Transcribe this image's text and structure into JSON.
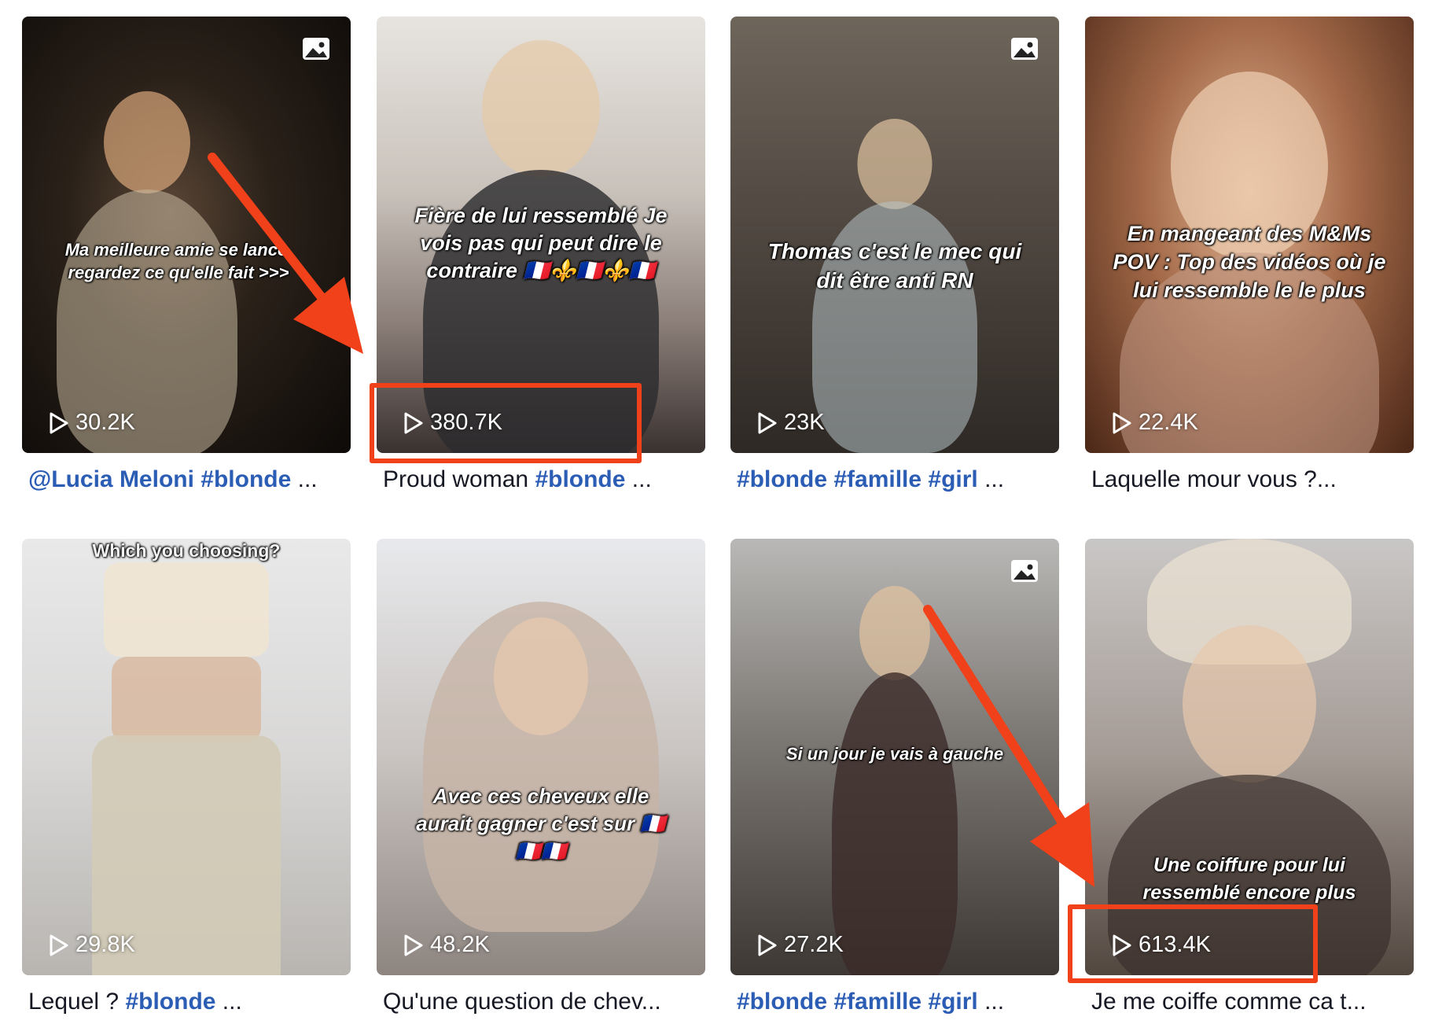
{
  "videos": [
    {
      "views": "30.2K",
      "overlay": "Ma meilleure amie se lance, regardez ce qu'elle fait >>>",
      "caption_user": "@Lucia Meloni",
      "caption_tag": "#blonde",
      "caption_rest": " ...",
      "has_photo_icon": true
    },
    {
      "views": "380.7K",
      "overlay": "Fière de lui ressemblé Je vois pas qui peut dire le contraire 🇫🇷⚜️🇫🇷⚜️🇫🇷",
      "caption_text": "Proud woman ",
      "caption_tag": "#blonde",
      "caption_rest": " ...",
      "has_photo_icon": false
    },
    {
      "views": "23K",
      "overlay": "Thomas c'est le mec qui dit être anti RN",
      "caption_tag": "#blonde #famille #girl",
      "caption_rest": " ...",
      "has_photo_icon": true
    },
    {
      "views": "22.4K",
      "overlay": "En mangeant des M&Ms POV : Top des vidéos où je lui ressemble le le plus",
      "caption_text": "Laquelle mour vous ?...",
      "has_photo_icon": false
    },
    {
      "views": "29.8K",
      "overlay": "Which you choosing?",
      "caption_text": "Lequel ? ",
      "caption_tag": "#blonde",
      "caption_rest": " ...",
      "has_photo_icon": false
    },
    {
      "views": "48.2K",
      "overlay": "Avec ces cheveux elle aurait gagner c'est sur 🇫🇷🇫🇷🇫🇷",
      "caption_text": "Qu'une question de chev...",
      "has_photo_icon": false
    },
    {
      "views": "27.2K",
      "overlay": "Si un jour je vais à gauche",
      "caption_tag": "#blonde #famille #girl",
      "caption_rest": " ...",
      "has_photo_icon": true
    },
    {
      "views": "613.4K",
      "overlay": "Une coiffure pour lui ressemblé encore plus",
      "caption_text": "Je me coiffe comme ca t...",
      "has_photo_icon": false
    }
  ],
  "colors": {
    "highlight": "#f0411a",
    "hashtag": "#2b5db5",
    "text": "#161823"
  },
  "icons": {
    "play": "play-icon",
    "photo": "photo-icon"
  }
}
